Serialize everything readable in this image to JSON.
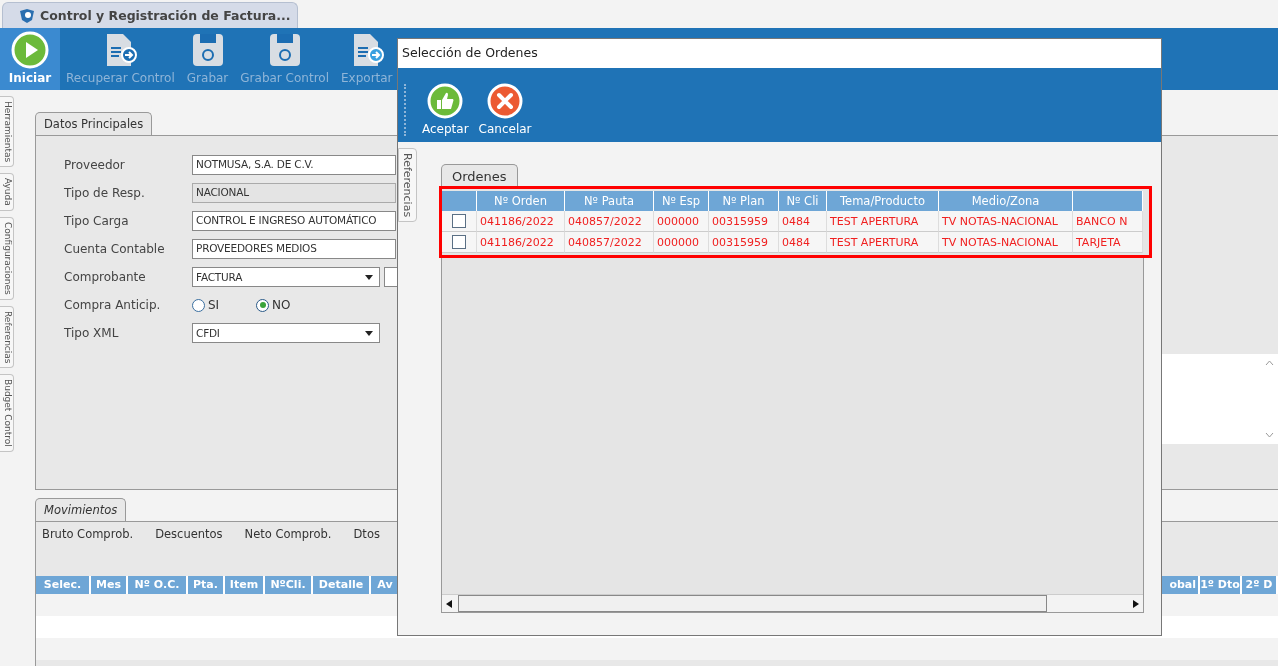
{
  "app": {
    "title": "Control y Registración de Factura..."
  },
  "toolbar": [
    {
      "label": "Iniciar",
      "disabled": false
    },
    {
      "label": "Recuperar Control",
      "disabled": true
    },
    {
      "label": "Grabar",
      "disabled": true
    },
    {
      "label": "Grabar Control",
      "disabled": true
    },
    {
      "label": "Exportar",
      "disabled": true
    }
  ],
  "side_tabs": [
    "Herramientas",
    "Ayuda",
    "Configuraciones",
    "Referencias",
    "Budget Control"
  ],
  "main_tab": "Datos Principales",
  "form": [
    {
      "kind": "text",
      "label": "Proveedor",
      "value": "NOTMUSA, S.A. DE C.V."
    },
    {
      "kind": "readonly",
      "label": "Tipo de Resp.",
      "value": "NACIONAL"
    },
    {
      "kind": "text",
      "label": "Tipo Carga",
      "value": "CONTROL E INGRESO AUTOMÁTICO"
    },
    {
      "kind": "text",
      "label": "Cuenta Contable",
      "value": "PROVEEDORES MEDIOS"
    },
    {
      "kind": "dropdown",
      "label": "Comprobante",
      "value": "FACTURA",
      "code_box": true
    },
    {
      "kind": "radio",
      "label": "Compra Anticip.",
      "options": [
        {
          "label": "SI",
          "selected": false
        },
        {
          "label": "NO",
          "selected": true
        }
      ]
    },
    {
      "kind": "dropdown",
      "label": "Tipo XML",
      "value": "CFDI",
      "code_box": false
    }
  ],
  "movements": {
    "tab": "Movimientos",
    "totals": [
      "Bruto Comprob.",
      "Descuentos",
      "Neto Comprob.",
      "Dtos"
    ],
    "columns_left": [
      "Selec.",
      "Mes",
      "Nº O.C.",
      "Pta.",
      "Item",
      "NºCli.",
      "Detalle",
      "Av"
    ],
    "columns_right": [
      "obal",
      "1º Dto",
      "2º D"
    ]
  },
  "dialog": {
    "title": "Selección de Ordenes",
    "buttons": [
      {
        "label": "Aceptar"
      },
      {
        "label": "Cancelar"
      }
    ],
    "side_tab": "Referencias",
    "tab": "Ordenes",
    "columns": [
      "Nº Orden",
      "Nº Pauta",
      "Nº Esp",
      "Nº Plan",
      "Nº Cli",
      "Tema/Producto",
      "Medio/Zona"
    ],
    "rows": [
      {
        "checked": false,
        "cells": [
          "041186/2022",
          "040857/2022",
          "000000",
          "00315959",
          "0484",
          "TEST APERTURA",
          "TV NOTAS-NACIONAL",
          "BANCO N"
        ]
      },
      {
        "checked": false,
        "cells": [
          "041186/2022",
          "040857/2022",
          "000000",
          "00315959",
          "0484",
          "TEST APERTURA",
          "TV NOTAS-NACIONAL",
          "TARJETA"
        ]
      }
    ]
  }
}
